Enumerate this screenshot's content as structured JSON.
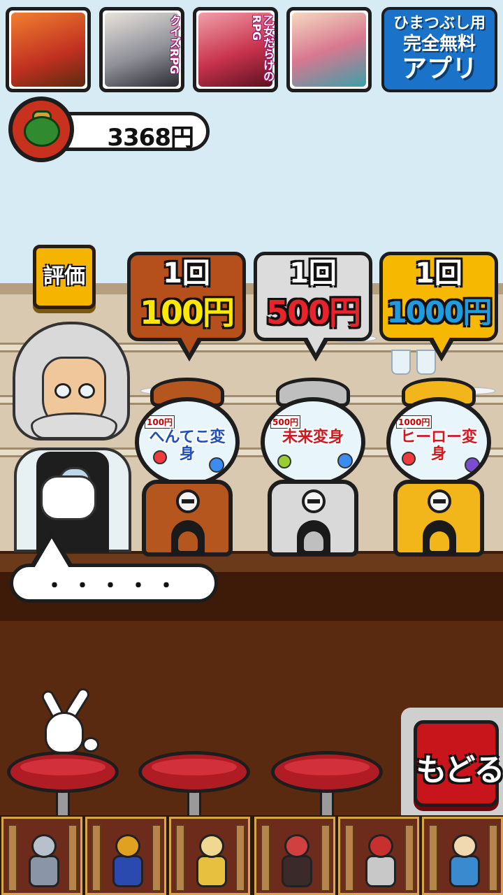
{
  "top_apps": [
    {
      "name": "app-icon-hero",
      "tag": "",
      "color": "#e0702a"
    },
    {
      "name": "app-icon-quiz-rpg",
      "tag": "クイズRPG",
      "color": "#6b6f78"
    },
    {
      "name": "app-icon-otome-rpg",
      "tag": "乙女だらけのRPG",
      "color": "#c8324c"
    },
    {
      "name": "app-icon-girl",
      "tag": "",
      "color": "#3aa0a8"
    }
  ],
  "ad_banner": {
    "line1": "ひまつぶし用",
    "line2": "完全無料",
    "line3": "アプリ"
  },
  "money": {
    "amount": "3368円"
  },
  "rate_button": {
    "label": "評価"
  },
  "speech": {
    "text": "・・・・・"
  },
  "back_button": {
    "label": "もどる"
  },
  "gachas": [
    {
      "times": "1回",
      "price": "100円",
      "sign_color": "#b5501c",
      "price_color": "#ffe800",
      "body_color": "#b5561e",
      "theme": "へんてこ変身",
      "badge": "100円"
    },
    {
      "times": "1回",
      "price": "500円",
      "sign_color": "#dcdcdc",
      "price_color": "#e8232c",
      "body_color": "#d9d9d9",
      "theme": "未来変身",
      "badge": "500円"
    },
    {
      "times": "1回",
      "price": "1000円",
      "sign_color": "#f6b800",
      "price_color": "#1f9be0",
      "body_color": "#f2b51a",
      "theme": "ヒーロー変身",
      "badge": "1000円"
    }
  ],
  "characters": [
    {
      "name": "character-knight",
      "color": "#8a95a8"
    },
    {
      "name": "character-ninja",
      "color": "#e0a020"
    },
    {
      "name": "character-paladin",
      "color": "#e8c040"
    },
    {
      "name": "character-dark-knight",
      "color": "#d04040"
    },
    {
      "name": "character-spartan",
      "color": "#c8c8c8"
    },
    {
      "name": "character-blue-warrior",
      "color": "#3a8ad0"
    }
  ]
}
